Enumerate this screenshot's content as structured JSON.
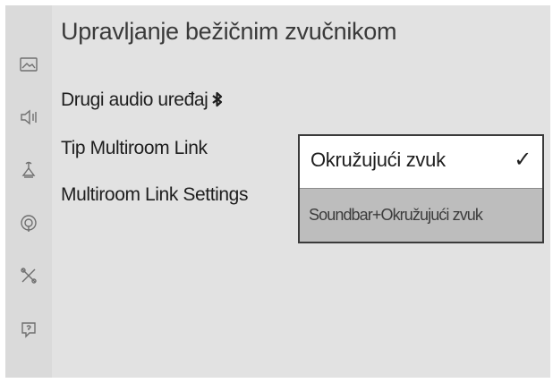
{
  "screen": {
    "title": "Upravljanje bežičnim zvučnikom"
  },
  "sidebar": {
    "icons": [
      {
        "name": "picture-icon"
      },
      {
        "name": "sound-icon"
      },
      {
        "name": "broadcast-icon"
      },
      {
        "name": "network-icon"
      },
      {
        "name": "tools-icon"
      },
      {
        "name": "support-icon"
      }
    ]
  },
  "menu": {
    "items": [
      {
        "label": "Drugi audio uređaj",
        "icon": "bluetooth-icon"
      },
      {
        "label": "Tip Multiroom Link"
      },
      {
        "label": "Multiroom Link Settings"
      }
    ]
  },
  "dropdown": {
    "options": [
      {
        "label": "Okružujući zvuk",
        "selected": true,
        "check": "✓"
      },
      {
        "label": "Soundbar+Okružujući zvuk",
        "selected": false
      }
    ]
  }
}
